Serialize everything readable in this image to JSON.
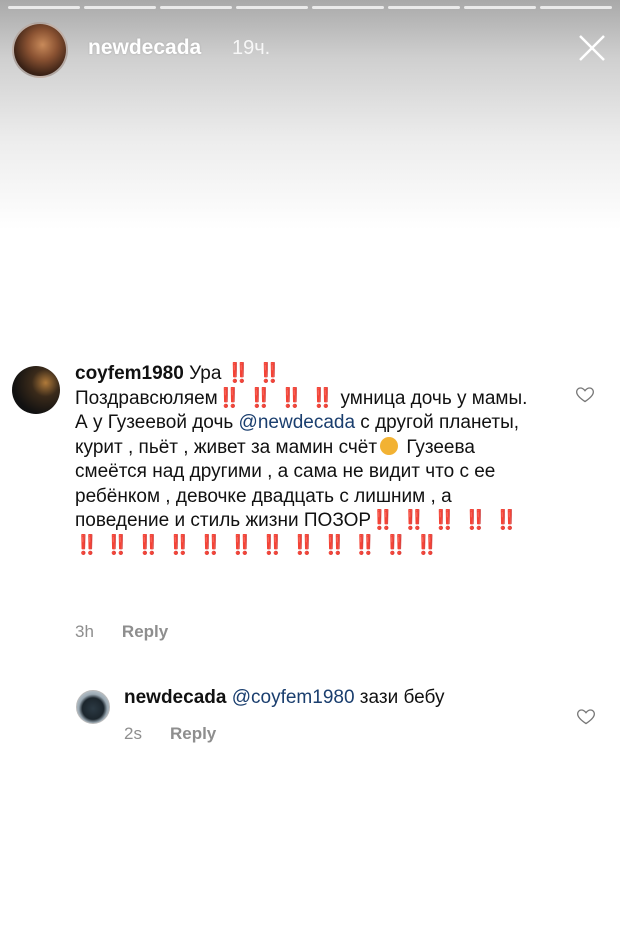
{
  "story": {
    "username": "newdecada",
    "time": "19ч.",
    "segments": 8
  },
  "comments": [
    {
      "username": "coyfem1980",
      "mention": "@newdecada",
      "part1": " Ура",
      "bang1": "‼️ ‼️",
      "part2": "Поздравсюляем",
      "bang2": "‼️ ‼️ ‼️ ‼️",
      "part3": " умница дочь у мамы. А у Гузеевой дочь ",
      "part4": " с другой планеты, курит , пьёт , живет за мамин счёт",
      "part5": " Гузеева смеётся над другими , а сама не видит что с ее ребёнком , девочке двадцать с лишним , а поведение и стиль жизни ПОЗОР",
      "bang3": "‼️ ‼️ ‼️ ‼️ ‼️ ‼️ ‼️ ‼️ ‼️ ‼️ ‼️ ‼️ ‼️ ‼️ ‼️ ‼️ ‼️",
      "time": "3h",
      "reply": "Reply"
    },
    {
      "username": "newdecada",
      "mention": "@coyfem1980",
      "text": " зази бебу",
      "time": "2s",
      "reply": "Reply"
    }
  ],
  "colors": {
    "mention": "#1a3e6e",
    "bang": "#e8121f",
    "meta": "#8e8e8e"
  }
}
